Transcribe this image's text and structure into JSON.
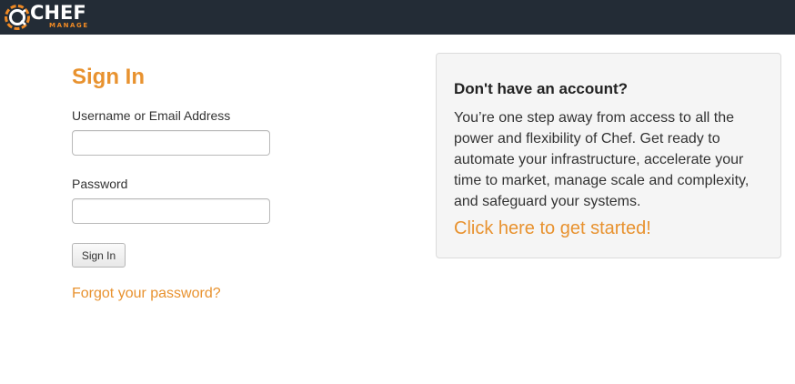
{
  "header": {
    "logo_text": "CHEF",
    "logo_subtext": "MANAGE",
    "logo_icon": "chef-logo-icon",
    "background_color": "#232c36"
  },
  "signin": {
    "title": "Sign In",
    "username_label": "Username or Email Address",
    "username_value": "",
    "password_label": "Password",
    "password_value": "",
    "submit_label": "Sign In",
    "forgot_link": "Forgot your password?"
  },
  "promo": {
    "title": "Don't have an account?",
    "body": "You’re one step away from access to all the power and flexibility of Chef. Get ready to automate your infrastructure, accelerate your time to market, manage scale and complexity, and safeguard your systems.",
    "cta": "Click here to get started!"
  },
  "colors": {
    "accent": "#e8922f",
    "panel_background": "#f5f5f5"
  }
}
